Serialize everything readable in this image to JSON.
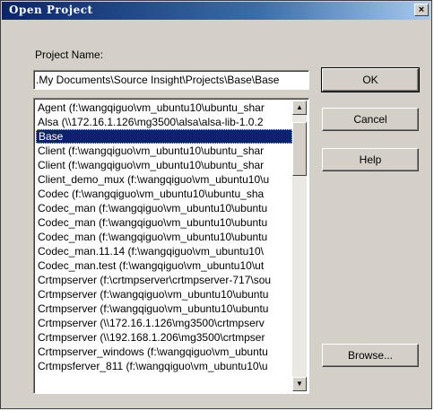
{
  "window": {
    "title": "Open Project",
    "close_label": "×"
  },
  "project_name": {
    "label": "Project Name:",
    "value": ".My Documents\\Source Insight\\Projects\\Base\\Base"
  },
  "project_list": [
    "Agent (f:\\wangqiguo\\vm_ubuntu10\\ubuntu_shar",
    "Alsa (\\\\172.16.1.126\\mg3500\\alsa\\alsa-lib-1.0.2",
    "Base",
    "Client (f:\\wangqiguo\\vm_ubuntu10\\ubuntu_shar",
    "Client (f:\\wangqiguo\\vm_ubuntu10\\ubuntu_shar",
    "Client_demo_mux (f:\\wangqiguo\\vm_ubuntu10\\u",
    "Codec (f:\\wangqiguo\\vm_ubuntu10\\ubuntu_sha",
    "Codec_man (f:\\wangqiguo\\vm_ubuntu10\\ubuntu",
    "Codec_man (f:\\wangqiguo\\vm_ubuntu10\\ubuntu",
    "Codec_man (f:\\wangqiguo\\vm_ubuntu10\\ubuntu",
    "Codec_man.11.14 (f:\\wangqiguo\\vm_ubuntu10\\",
    "Codec_man.test (f:\\wangqiguo\\vm_ubuntu10\\ut",
    "Crtmpserver (f:\\crtmpserver\\crtmpserver-717\\sou",
    "Crtmpserver (f:\\wangqiguo\\vm_ubuntu10\\ubuntu",
    "Crtmpserver (f:\\wangqiguo\\vm_ubuntu10\\ubuntu",
    "Crtmpserver (\\\\172.16.1.126\\mg3500\\crtmpserv",
    "Crtmpserver (\\\\192.168.1.206\\mg3500\\crtmpser",
    "Crtmpserver_windows (f:\\wangqiguo\\vm_ubuntu",
    "Crtmpsferver_811 (f:\\wangqiguo\\vm_ubuntu10\\u"
  ],
  "selected_index": 2,
  "buttons": {
    "ok": "OK",
    "cancel": "Cancel",
    "help": "Help",
    "browse": "Browse..."
  }
}
